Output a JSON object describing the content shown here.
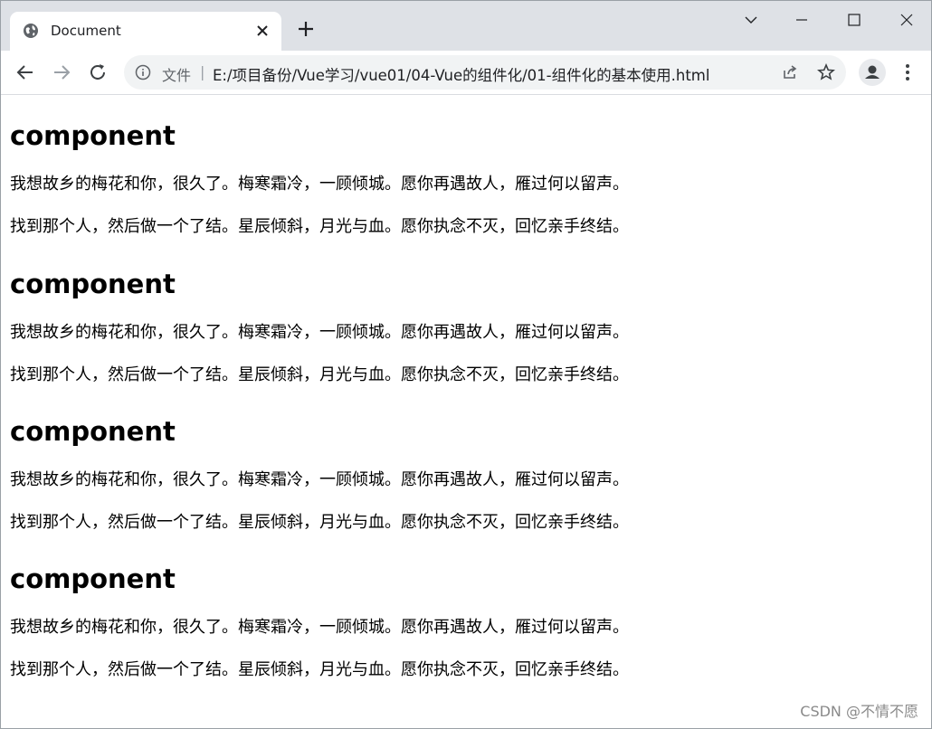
{
  "browser": {
    "tab_title": "Document",
    "site_label": "文件",
    "site_separator": "|",
    "url": "E:/项目备份/Vue学习/vue01/04-Vue的组件化/01-组件化的基本使用.html",
    "icons": {
      "tab": "globe-icon",
      "close": "close-icon",
      "new_tab": "plus-icon",
      "back": "back-arrow-icon",
      "forward": "forward-arrow-icon",
      "reload": "reload-icon",
      "info": "info-icon",
      "share": "share-icon",
      "bookmark": "star-icon",
      "profile": "profile-icon",
      "menu": "kebab-menu-icon",
      "tab_search": "chevron-down-icon",
      "minimize": "minimize-icon",
      "maximize": "maximize-icon",
      "window_close": "window-close-icon"
    }
  },
  "page": {
    "components": [
      {
        "heading": "component",
        "line1": "我想故乡的梅花和你，很久了。梅寒霜冷，一顾倾城。愿你再遇故人，雁过何以留声。",
        "line2": "找到那个人，然后做一个了结。星辰倾斜，月光与血。愿你执念不灭，回忆亲手终结。"
      },
      {
        "heading": "component",
        "line1": "我想故乡的梅花和你，很久了。梅寒霜冷，一顾倾城。愿你再遇故人，雁过何以留声。",
        "line2": "找到那个人，然后做一个了结。星辰倾斜，月光与血。愿你执念不灭，回忆亲手终结。"
      },
      {
        "heading": "component",
        "line1": "我想故乡的梅花和你，很久了。梅寒霜冷，一顾倾城。愿你再遇故人，雁过何以留声。",
        "line2": "找到那个人，然后做一个了结。星辰倾斜，月光与血。愿你执念不灭，回忆亲手终结。"
      },
      {
        "heading": "component",
        "line1": "我想故乡的梅花和你，很久了。梅寒霜冷，一顾倾城。愿你再遇故人，雁过何以留声。",
        "line2": "找到那个人，然后做一个了结。星辰倾斜，月光与血。愿你执念不灭，回忆亲手终结。"
      }
    ]
  },
  "watermark": "CSDN @不情不愿",
  "colors": {
    "tabstrip": "#dee1e6",
    "omnibox": "#f1f3f4",
    "icon": "#5f6368"
  }
}
